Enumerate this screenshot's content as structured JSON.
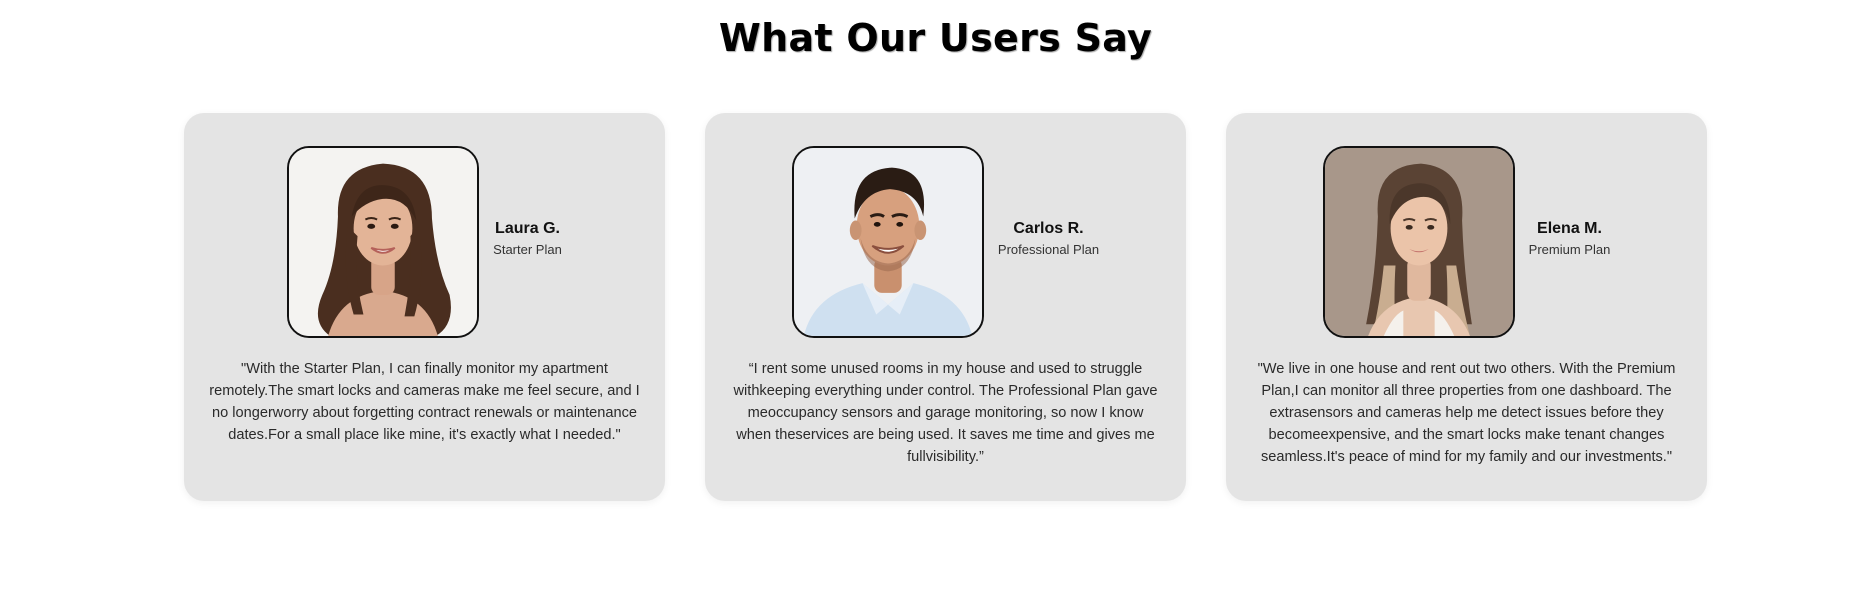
{
  "section": {
    "title": "What Our Users Say"
  },
  "testimonials": [
    {
      "name": "Laura G.",
      "plan": "Starter Plan",
      "avatar_icon": "woman-portrait-photo",
      "avatar_bg": "#f2f1ef",
      "quote": "\"With the Starter Plan, I can finally monitor my apartment remotely.The smart locks and cameras make me feel secure, and I no longerworry about forgetting contract renewals or maintenance dates.For a small place like mine, it's exactly what I needed.\""
    },
    {
      "name": "Carlos R.",
      "plan": "Professional Plan",
      "avatar_icon": "man-portrait-photo",
      "avatar_bg": "#eef0f3",
      "quote": "“I rent some unused rooms in my house and used to struggle withkeeping everything under control. The Professional Plan gave meoccupancy sensors and garage monitoring, so now I know when theservices are being used. It saves me time and gives me fullvisibility.”"
    },
    {
      "name": "Elena M.",
      "plan": "Premium Plan",
      "avatar_icon": "woman-portrait-photo",
      "avatar_bg": "#a8978a",
      "quote": "\"We live in one house and rent out two others. With the Premium Plan,I can monitor all three properties from one dashboard. The extrasensors and cameras help me detect issues before they becomeexpensive, and the smart locks make tenant changes seamless.It's peace of mind for my family and our investments.\""
    }
  ]
}
